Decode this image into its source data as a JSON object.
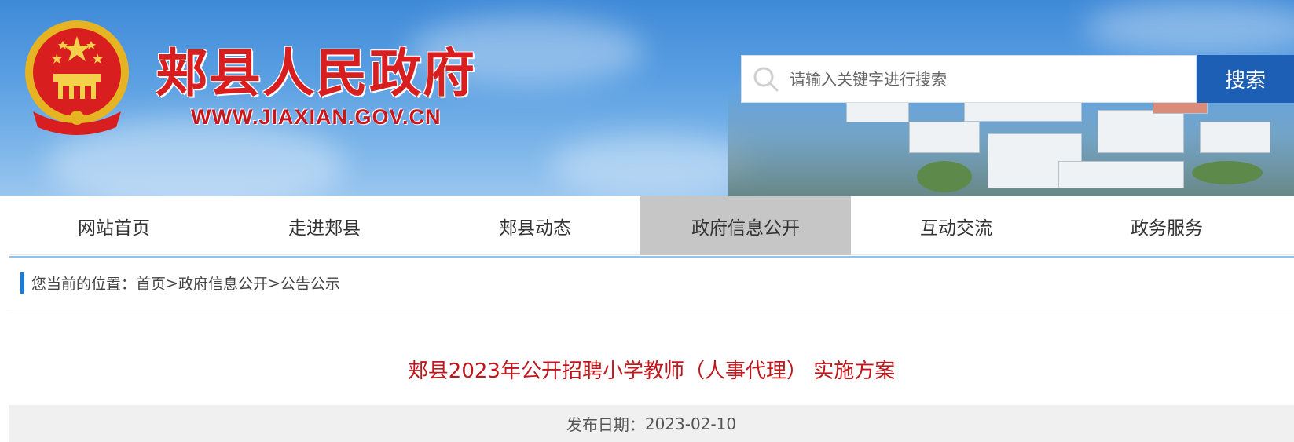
{
  "header": {
    "site_title": "郏县人民政府",
    "site_url": "WWW.JIAXIAN.GOV.CN",
    "search": {
      "placeholder": "请输入关键字进行搜索",
      "button_label": "搜索"
    },
    "emblem_icon": "national-emblem-icon"
  },
  "nav": {
    "items": [
      {
        "label": "网站首页",
        "active": false
      },
      {
        "label": "走进郏县",
        "active": false
      },
      {
        "label": "郏县动态",
        "active": false
      },
      {
        "label": "政府信息公开",
        "active": true
      },
      {
        "label": "互动交流",
        "active": false
      },
      {
        "label": "政务服务",
        "active": false
      }
    ]
  },
  "breadcrumb": {
    "label": "您当前的位置：",
    "items": [
      "首页",
      "政府信息公开",
      "公告公示"
    ],
    "separator": ">"
  },
  "article": {
    "title": "郏县2023年公开招聘小学教师（人事代理） 实施方案",
    "publish_date_label": "发布日期：",
    "publish_date": "2023-02-10"
  },
  "colors": {
    "title_red": "#d81e1e",
    "search_button_blue": "#1c5fb5",
    "active_nav_gray": "#c6c6c6",
    "breadcrumb_accent": "#1d7bd8",
    "article_title_red": "#c0171c"
  }
}
